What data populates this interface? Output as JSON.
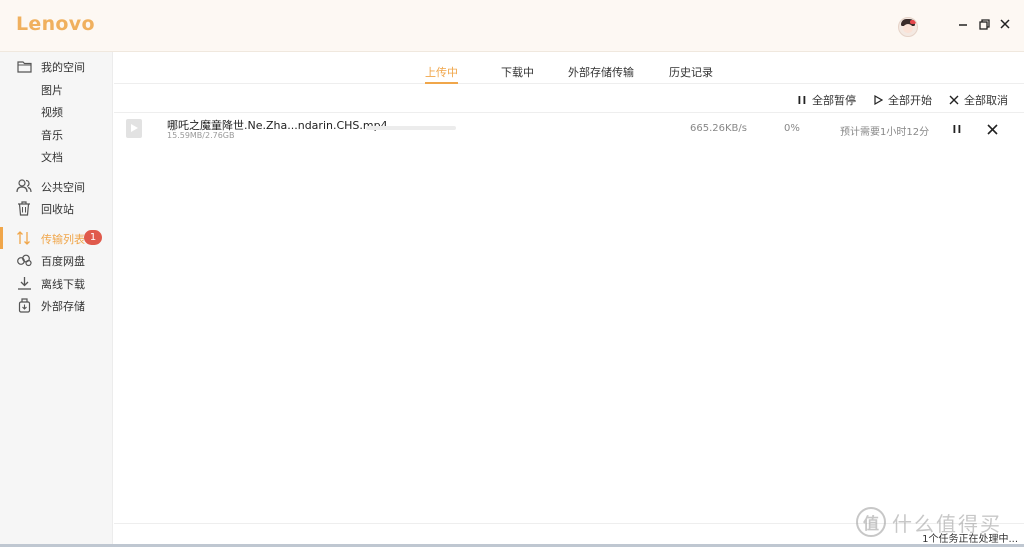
{
  "app": {
    "logo": "Lenovo"
  },
  "window_controls": {
    "minimize": "—",
    "maximize": "❐",
    "close": "✕"
  },
  "sidebar": {
    "items": [
      {
        "label": "我的空间",
        "icon": "folder-icon"
      },
      {
        "label": "图片"
      },
      {
        "label": "视频"
      },
      {
        "label": "音乐"
      },
      {
        "label": "文档"
      },
      {
        "label": "公共空间",
        "icon": "people-icon"
      },
      {
        "label": "回收站",
        "icon": "trash-icon"
      },
      {
        "label": "传输列表",
        "icon": "transfer-icon",
        "active": true,
        "badge": "1"
      },
      {
        "label": "百度网盘",
        "icon": "cloud-icon"
      },
      {
        "label": "离线下载",
        "icon": "download-icon"
      },
      {
        "label": "外部存储",
        "icon": "external-storage-icon"
      }
    ]
  },
  "tabs": [
    {
      "label": "上传中",
      "active": true
    },
    {
      "label": "下载中"
    },
    {
      "label": "外部存储传输"
    },
    {
      "label": "历史记录"
    }
  ],
  "toolbar": {
    "pause_all": "全部暂停",
    "start_all": "全部开始",
    "cancel_all": "全部取消"
  },
  "transfers": [
    {
      "name": "哪吒之魔童降世.Ne.Zha...ndarin.CHS.mp4",
      "size": "15.59MB/2.76GB",
      "speed": "665.26KB/s",
      "percent": "0%",
      "progress": 0.0,
      "eta": "预计需要1小时12分"
    }
  ],
  "status": {
    "text": "1个任务正在处理中..."
  },
  "watermark": {
    "text": "什么值得买",
    "glyph": "值"
  },
  "colors": {
    "accent": "#f0a64a",
    "badge": "#e05a4c",
    "logo": "#f0b05e"
  }
}
